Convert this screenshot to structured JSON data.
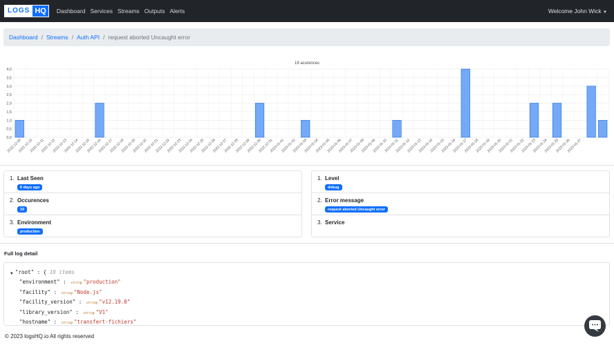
{
  "nav": {
    "brand_left": "LOGS",
    "brand_right": "HQ",
    "links": [
      "Dashboard",
      "Services",
      "Streams",
      "Outputs",
      "Alerts"
    ],
    "welcome": "Welcome John Wick"
  },
  "breadcrumb": {
    "items": [
      "Dashboard",
      "Streams",
      "Auth API"
    ],
    "separator": "/",
    "current": "request aborted Uncaught error"
  },
  "chart_data": {
    "type": "bar",
    "title": "19 acurences",
    "ylim": [
      0,
      4
    ],
    "yticks": [
      "0,0",
      "0,5",
      "1,0",
      "1,5",
      "2,0",
      "2,5",
      "3,0",
      "3,5",
      "4,0"
    ],
    "categories": [
      "2022-12-09",
      "2022-12-10",
      "2022-12-11",
      "2022-12-12",
      "2022-12-13",
      "2022-12-14",
      "2022-12-15",
      "2022-12-16",
      "2022-12-17",
      "2022-12-18",
      "2022-12-19",
      "2022-12-20",
      "2022-12-21",
      "2022-12-22",
      "2022-12-23",
      "2022-12-24",
      "2022-12-25",
      "2022-12-26",
      "2022-12-27",
      "2022-12-28",
      "2022-12-29",
      "2022-12-30",
      "2022-12-31",
      "2023-01-01",
      "2023-01-02",
      "2023-01-03",
      "2023-01-04",
      "2023-01-05",
      "2023-01-06",
      "2023-01-07",
      "2023-01-08",
      "2023-01-09",
      "2023-01-10",
      "2023-01-11",
      "2023-01-12",
      "2023-01-13",
      "2023-01-14",
      "2023-01-15",
      "2023-01-16",
      "2023-01-17",
      "2023-01-18",
      "2023-01-19",
      "2023-01-20",
      "2023-01-21",
      "2023-01-22",
      "2023-01-23",
      "2023-01-24",
      "2023-01-25",
      "2023-01-26",
      "2023-01-27"
    ],
    "values": [
      1,
      0,
      0,
      0,
      0,
      0,
      0,
      2,
      0,
      0,
      0,
      0,
      0,
      0,
      0,
      0,
      0,
      0,
      0,
      0,
      0,
      2,
      0,
      0,
      0,
      1,
      0,
      0,
      0,
      0,
      0,
      0,
      0,
      1,
      0,
      0,
      0,
      0,
      0,
      4,
      0,
      0,
      0,
      0,
      0,
      2,
      0,
      2,
      0,
      0,
      3,
      1
    ],
    "grid": true,
    "bar_color": "#74a9f7",
    "bar_border": "#1f6fe0"
  },
  "left_card": [
    {
      "num": "1.",
      "title": "Last Seen",
      "badge": "6 days ago"
    },
    {
      "num": "2.",
      "title": "Occurences",
      "badge": "19"
    },
    {
      "num": "3.",
      "title": "Environment",
      "badge": "production"
    }
  ],
  "right_card": [
    {
      "num": "1.",
      "title": "Level",
      "badge": "debug"
    },
    {
      "num": "2.",
      "title": "Error message",
      "badge": "request aborted Uncaught error"
    },
    {
      "num": "3.",
      "title": "Service",
      "badge": ""
    }
  ],
  "log": {
    "section_title": "Full log detail",
    "root_key": "\"root\"",
    "root_meta": "10 items",
    "lines": [
      {
        "key": "\"environment\"",
        "type": "string",
        "val": "\"production\""
      },
      {
        "key": "\"facility\"",
        "type": "string",
        "val": "\"Node.js\""
      },
      {
        "key": "\"facility_version\"",
        "type": "string",
        "val": "\"v12.19.0\""
      },
      {
        "key": "\"library_version\"",
        "type": "string",
        "val": "\"V1\""
      },
      {
        "key": "\"hostname\"",
        "type": "string",
        "val": "\"transfert-fichiers\""
      }
    ]
  },
  "footer": "© 2023 logsHQ.io All rights reserved"
}
